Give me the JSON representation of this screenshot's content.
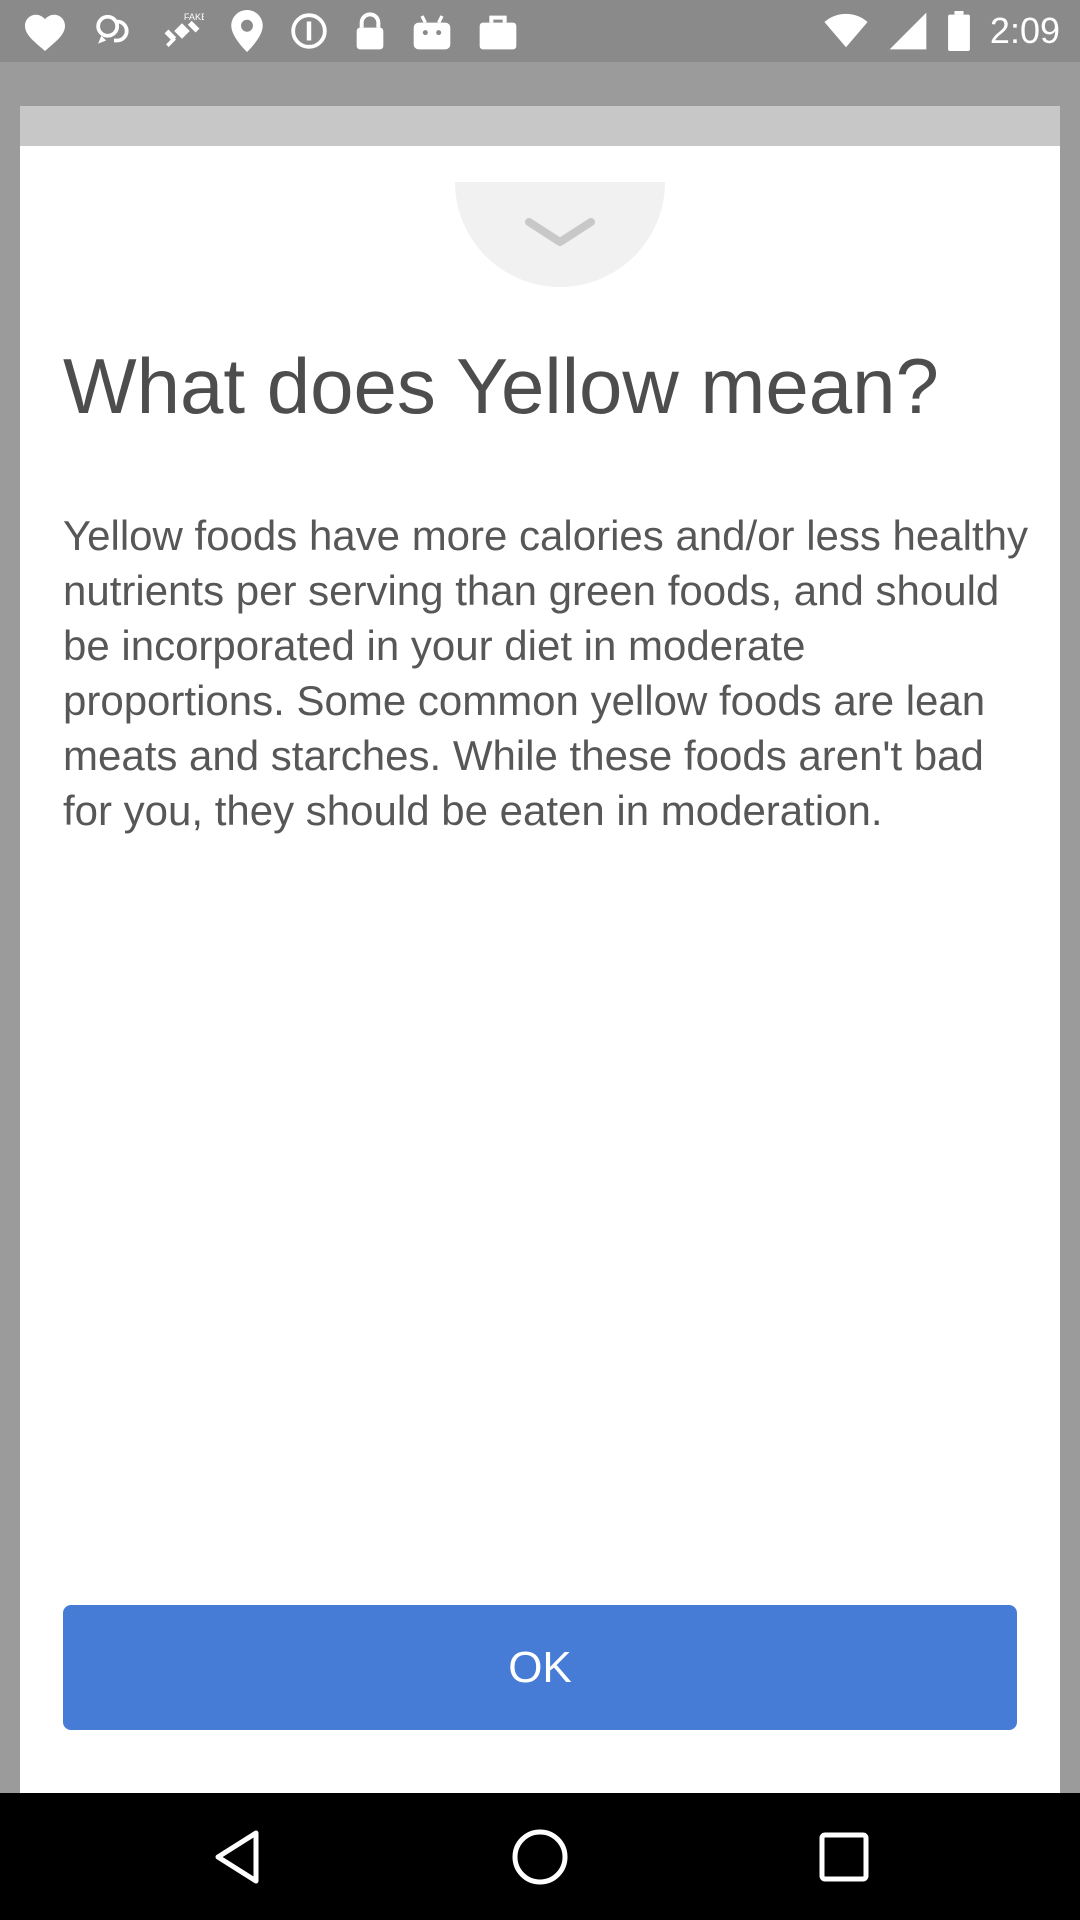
{
  "status_bar": {
    "time": "2:09",
    "icons": [
      "heart-icon",
      "chat-bubbles-icon",
      "fake-gps-satellite-icon",
      "location-pin-icon",
      "info-circle-icon",
      "lock-icon",
      "android-bag-icon",
      "shopping-bag-icon",
      "wifi-icon",
      "signal-icon",
      "battery-icon"
    ]
  },
  "dialog": {
    "title": "What does Yellow mean?",
    "body": "Yellow foods have more calories and/or less healthy nutrients per serving than green foods, and should be incorporated in your diet in moderate proportions. Some common yellow foods are lean meats and starches. While these foods aren't bad for you, they should be eaten in moderation.",
    "ok_label": "OK"
  },
  "nav_bar": {
    "buttons": [
      "back-icon",
      "home-icon",
      "recents-icon"
    ]
  },
  "colors": {
    "button": "#467cd6",
    "title_text": "#4d4d4d",
    "body_text": "#575757",
    "backdrop": "#9b9b9b"
  }
}
